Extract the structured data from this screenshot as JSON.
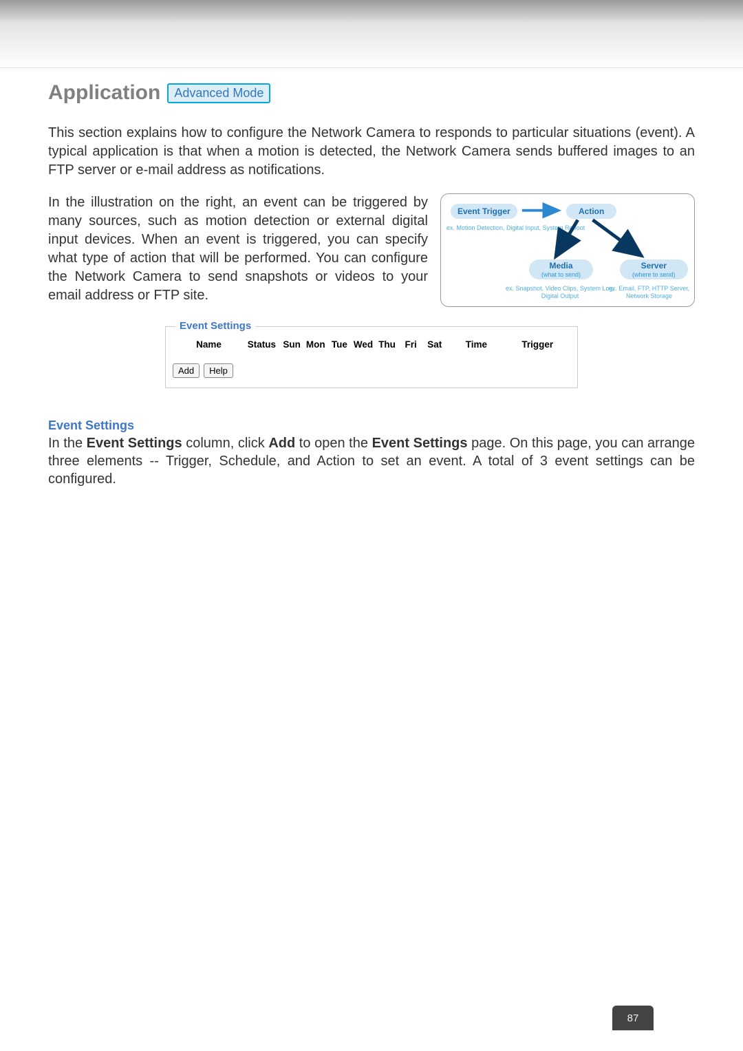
{
  "header": {
    "title": "Application",
    "mode_badge": "Advanced Mode"
  },
  "intro": {
    "p1": "This section explains how to configure the Network Camera to responds to particular situations (event). A typical application is that when a motion is detected, the Network Camera sends buffered images to an FTP server or e-mail address as notifications.",
    "p2": "In the illustration on the right, an event can be triggered by many sources, such as motion detection or external digital input devices. When an event is triggered, you can specify what type of action that will be performed. You can configure the Network Camera to send snapshots or videos to your email address or FTP site."
  },
  "diagram": {
    "event_trigger_label": "Event Trigger",
    "event_trigger_ex": "ex. Motion Detection,\nDigital Input,\nSystem Reboot",
    "action_label": "Action",
    "media_label": "Media",
    "media_sub": "(what to send)",
    "media_ex": "ex. Snapshot, Video Clips,\nSystem Log, Digital Output",
    "server_label": "Server",
    "server_sub": "(where to send)",
    "server_ex": "ex. Email, FTP, HTTP Server,\nNetwork Storage"
  },
  "event_settings_panel": {
    "legend": "Event Settings",
    "columns": [
      "Name",
      "Status",
      "Sun",
      "Mon",
      "Tue",
      "Wed",
      "Thu",
      "Fri",
      "Sat",
      "Time",
      "Trigger"
    ],
    "buttons": {
      "add": "Add",
      "help": "Help"
    }
  },
  "event_settings_section": {
    "heading": "Event Settings",
    "body_1": "In the ",
    "body_bold_1": "Event Settings",
    "body_2": " column, click ",
    "body_bold_2": "Add",
    "body_3": " to open the ",
    "body_bold_3": "Event Settings",
    "body_4": " page. On this page, you can arrange three elements -- Trigger, Schedule, and Action to set an event. A total of 3 event settings can be configured."
  },
  "page_number": "87"
}
